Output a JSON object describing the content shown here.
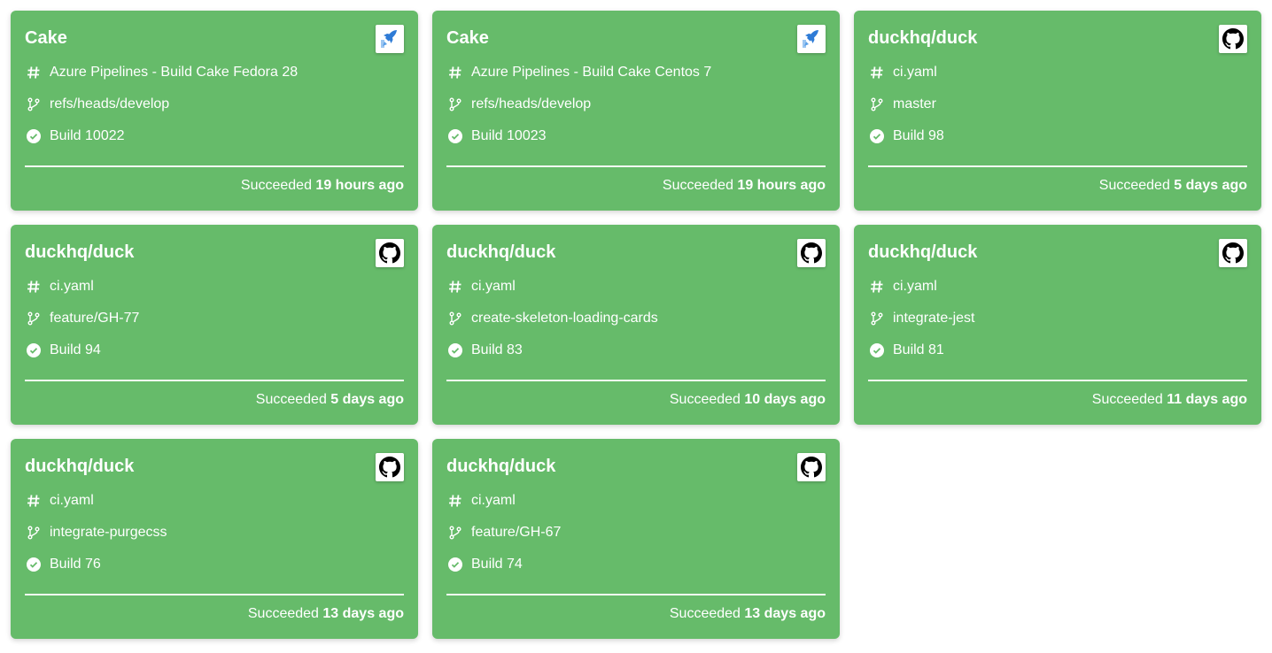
{
  "cards": [
    {
      "title": "Cake",
      "provider_icon": "azure-pipelines-icon",
      "pipeline": "Azure Pipelines - Build Cake Fedora 28",
      "branch": "refs/heads/develop",
      "build": "Build 10022",
      "status": "Succeeded",
      "time": "19 hours ago"
    },
    {
      "title": "Cake",
      "provider_icon": "azure-pipelines-icon",
      "pipeline": "Azure Pipelines - Build Cake Centos 7",
      "branch": "refs/heads/develop",
      "build": "Build 10023",
      "status": "Succeeded",
      "time": "19 hours ago"
    },
    {
      "title": "duckhq/duck",
      "provider_icon": "github-icon",
      "pipeline": "ci.yaml",
      "branch": "master",
      "build": "Build 98",
      "status": "Succeeded",
      "time": "5 days ago"
    },
    {
      "title": "duckhq/duck",
      "provider_icon": "github-icon",
      "pipeline": "ci.yaml",
      "branch": "feature/GH-77",
      "build": "Build 94",
      "status": "Succeeded",
      "time": "5 days ago"
    },
    {
      "title": "duckhq/duck",
      "provider_icon": "github-icon",
      "pipeline": "ci.yaml",
      "branch": "create-skeleton-loading-cards",
      "build": "Build 83",
      "status": "Succeeded",
      "time": "10 days ago"
    },
    {
      "title": "duckhq/duck",
      "provider_icon": "github-icon",
      "pipeline": "ci.yaml",
      "branch": "integrate-jest",
      "build": "Build 81",
      "status": "Succeeded",
      "time": "11 days ago"
    },
    {
      "title": "duckhq/duck",
      "provider_icon": "github-icon",
      "pipeline": "ci.yaml",
      "branch": "integrate-purgecss",
      "build": "Build 76",
      "status": "Succeeded",
      "time": "13 days ago"
    },
    {
      "title": "duckhq/duck",
      "provider_icon": "github-icon",
      "pipeline": "ci.yaml",
      "branch": "feature/GH-67",
      "build": "Build 74",
      "status": "Succeeded",
      "time": "13 days ago"
    }
  ],
  "colors": {
    "success": "#66bb6a",
    "text": "#ffffff",
    "azure": "#2e7bd6"
  }
}
